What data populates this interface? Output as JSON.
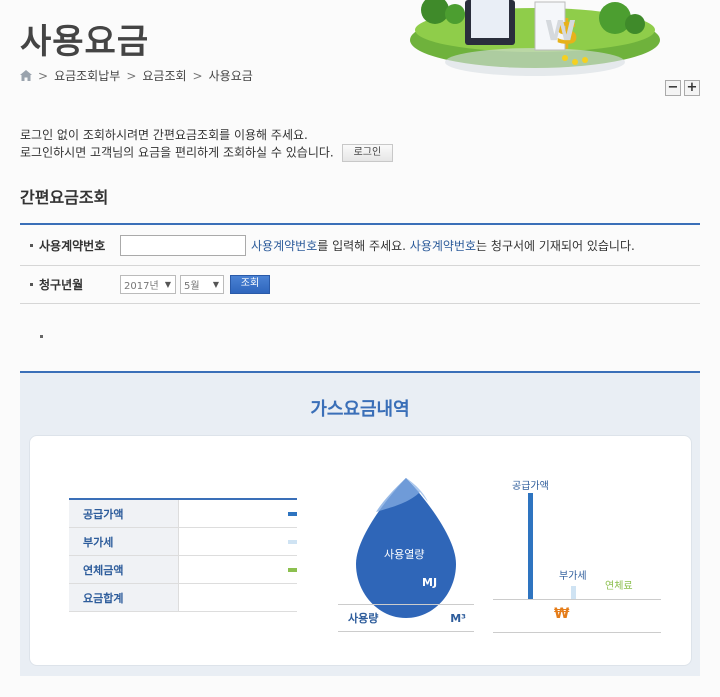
{
  "header": {
    "title": "사용요금",
    "breadcrumb": [
      "요금조회납부",
      "요금조회",
      "사용요금"
    ],
    "zoom_out": "−",
    "zoom_in": "+"
  },
  "intro": {
    "line1": "로그인 없이 조회하시려면 간편요금조회를 이용해 주세요.",
    "line2": "로그인하시면 고객님의 요금을 편리하게 조회하실 수 있습니다.",
    "login_button": "로그인"
  },
  "quick_inquiry": {
    "title": "간편요금조회",
    "contract_label": "사용계약번호",
    "contract_value": "",
    "hint_link1": "사용계약번호",
    "hint_mid": "를 입력해 주세요. ",
    "hint_link2": "사용계약번호",
    "hint_end": "는 청구서에 기재되어 있습니다.",
    "billing_label": "청구년월",
    "year_selected": "2017년",
    "month_selected": "5월",
    "search_button": "조회"
  },
  "result": {
    "title": "가스요금내역",
    "fee_rows": [
      {
        "label": "공급가액",
        "color": "#2e74c0"
      },
      {
        "label": "부가세",
        "color": "#cfe3f3"
      },
      {
        "label": "연체금액",
        "color": "#8cc04f"
      },
      {
        "label": "요금합계",
        "color": ""
      }
    ],
    "drop_label": "사용열량",
    "drop_unit": "MJ",
    "usage_label": "사용량",
    "usage_unit": "M³",
    "bar_labels": {
      "supply": "공급가액",
      "vat": "부가세",
      "late": "연체료"
    },
    "currency_symbol": "₩"
  },
  "colors": {
    "accent": "#3a6fb8",
    "link": "#2d5c9b",
    "won": "#e57d1a"
  }
}
